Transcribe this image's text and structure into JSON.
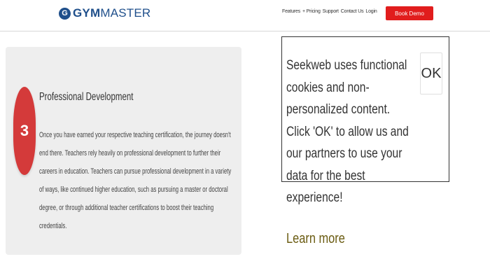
{
  "header": {
    "logo_badge": "G",
    "logo_bold": "GYM",
    "logo_light": "MASTER",
    "nav": [
      "Features",
      "+ Pricing",
      "Support",
      "Contact Us",
      "Login"
    ],
    "cta_label": "Book Demo",
    "cta_color": "#e11d1d"
  },
  "card": {
    "step_number": "3",
    "title": "Professional Development",
    "body": "Once you have earned your respective teaching certification, the journey doesn't end there. Teachers rely heavily on professional development to further their careers in education. Teachers can pursue professional development in a variety of ways, like continued higher education, such as pursuing a master or doctoral degree, or through additional teacher certifications to boost their teaching credentials."
  },
  "cookie": {
    "message": "Seekweb uses functional cookies and non-personalized content. Click 'OK' to allow us and our partners to use your data for the best experience!",
    "ok_label": "OK",
    "learn_more": "Learn more"
  }
}
